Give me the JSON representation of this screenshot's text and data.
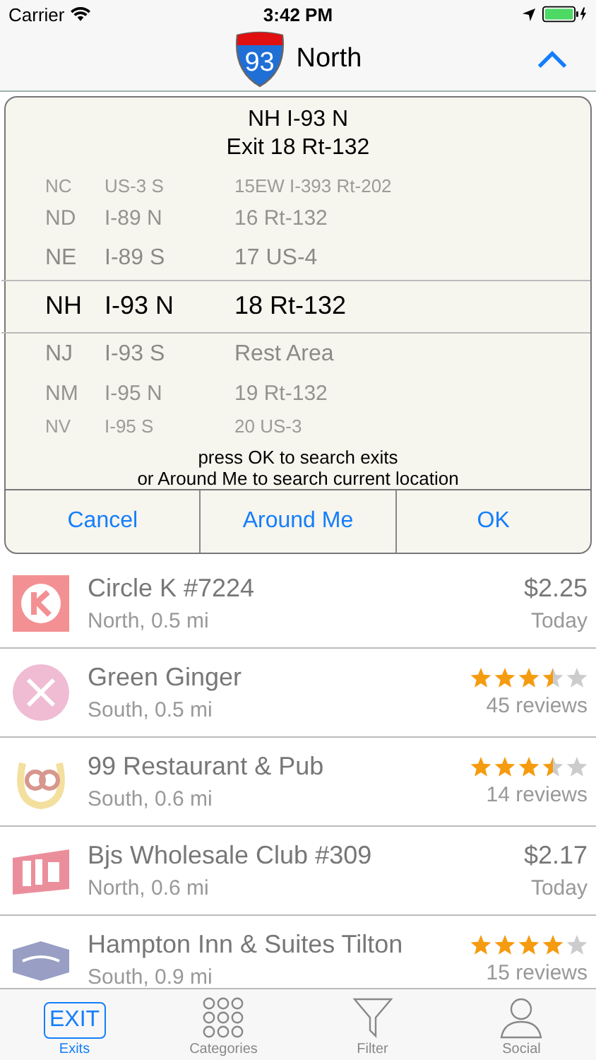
{
  "status_bar": {
    "carrier": "Carrier",
    "time": "3:42 PM"
  },
  "nav": {
    "route_number": "93",
    "title": "North"
  },
  "picker_dialog": {
    "heading_line1": "NH I-93 N",
    "heading_line2": "Exit 18 Rt-132",
    "rows": [
      {
        "state": "NC",
        "highway": "US-3 S",
        "exit": "15EW I-393 Rt-202",
        "selected": false
      },
      {
        "state": "ND",
        "highway": "I-89 N",
        "exit": "16 Rt-132",
        "selected": false
      },
      {
        "state": "NE",
        "highway": "I-89 S",
        "exit": "17 US-4",
        "selected": false
      },
      {
        "state": "NH",
        "highway": "I-93 N",
        "exit": "18 Rt-132",
        "selected": true
      },
      {
        "state": "NJ",
        "highway": "I-93 S",
        "exit": "Rest Area",
        "selected": false
      },
      {
        "state": "NM",
        "highway": "I-95 N",
        "exit": "19 Rt-132",
        "selected": false
      },
      {
        "state": "NV",
        "highway": "I-95 S",
        "exit": "20 US-3",
        "selected": false
      }
    ],
    "hint_line1": "press OK to search exits",
    "hint_line2": "or Around Me to search current location",
    "buttons": [
      "Cancel",
      "Around Me",
      "OK"
    ]
  },
  "places": [
    {
      "name": "Circle K #7224",
      "detail": "North, 0.5 mi",
      "kind": "price",
      "price": "$2.25",
      "date": "Today"
    },
    {
      "name": "Green Ginger",
      "detail": "South, 0.5 mi",
      "kind": "rating",
      "stars": 3.5,
      "reviews": "45 reviews"
    },
    {
      "name": "99 Restaurant & Pub",
      "detail": "South, 0.6 mi",
      "kind": "rating",
      "stars": 3.5,
      "reviews": "14 reviews"
    },
    {
      "name": "Bjs Wholesale Club #309",
      "detail": "North, 0.6 mi",
      "kind": "price",
      "price": "$2.17",
      "date": "Today"
    },
    {
      "name": "Hampton Inn & Suites Tilton",
      "detail": "South, 0.9 mi",
      "kind": "rating",
      "stars": 4,
      "reviews": "15 reviews"
    }
  ],
  "tab_bar": [
    {
      "badge": "EXIT",
      "label": "Exits",
      "selected": true
    },
    {
      "label": "Categories",
      "selected": false
    },
    {
      "label": "Filter",
      "selected": false
    },
    {
      "label": "Social",
      "selected": false
    }
  ]
}
